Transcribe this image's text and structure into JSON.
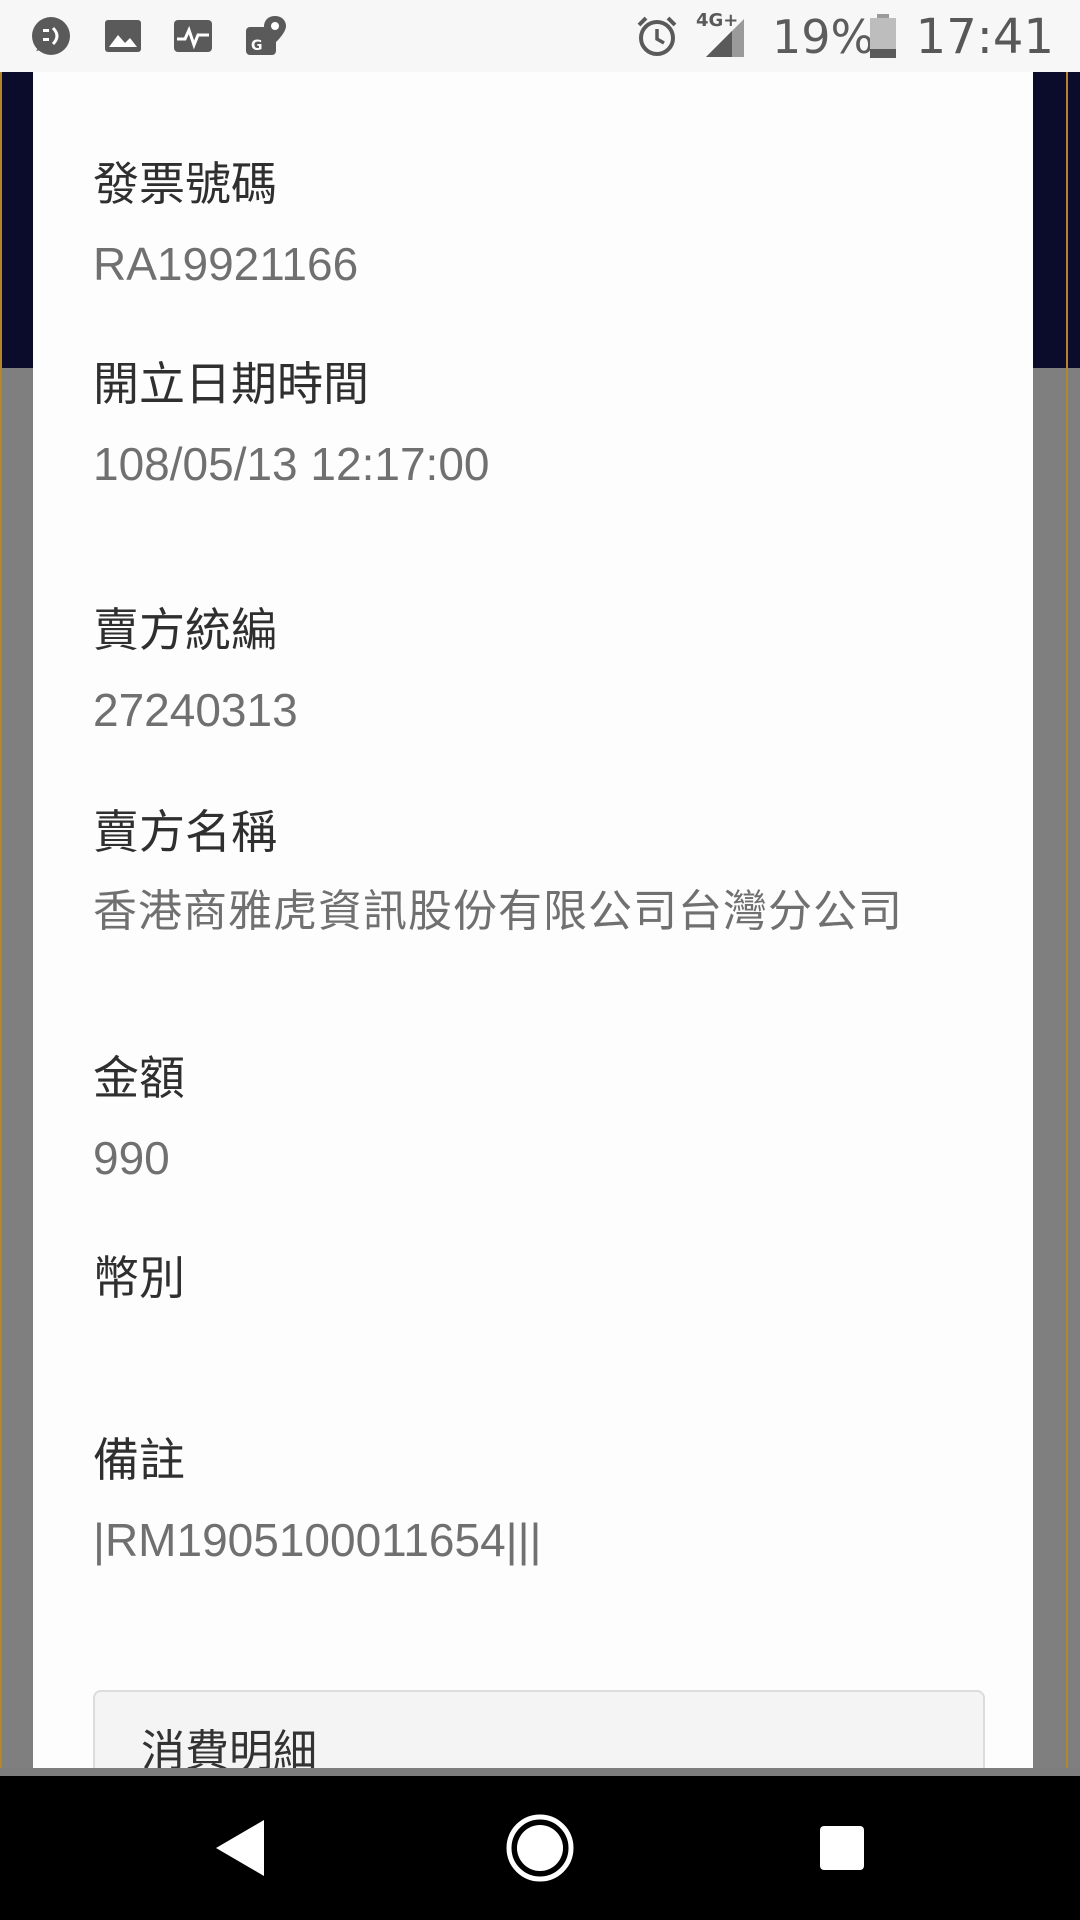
{
  "status_bar": {
    "left_icons": [
      "chat-bubble-icon",
      "image-icon",
      "activity-icon",
      "map-pin-icon"
    ],
    "alarm_icon": "alarm-clock-icon",
    "network_label": "4G+",
    "signal_icon": "cell-signal-icon",
    "battery_percent": "19%",
    "battery_icon": "battery-icon",
    "time": "17:41"
  },
  "invoice": {
    "fields": [
      {
        "label": "發票號碼",
        "value": "RA19921166"
      },
      {
        "label": "開立日期時間",
        "value": "108/05/13 12:17:00"
      },
      {
        "label": "賣方統編",
        "value": "27240313"
      },
      {
        "label": "賣方名稱",
        "value": "香港商雅虎資訊股份有限公司台灣分公司"
      },
      {
        "label": "金額",
        "value": "990"
      },
      {
        "label": "幣別",
        "value": ""
      },
      {
        "label": "備註",
        "value": "|RM1905100011654|||"
      }
    ],
    "details_title": "消費明細"
  },
  "nav_bar": {
    "back_icon": "back-triangle-icon",
    "home_icon": "home-circle-icon",
    "recents_icon": "recents-square-icon"
  },
  "colors": {
    "header_navy": "#0b0b2b",
    "accent_gold": "#b5852c",
    "label_text": "#2f2f2f",
    "value_text": "#707070"
  }
}
